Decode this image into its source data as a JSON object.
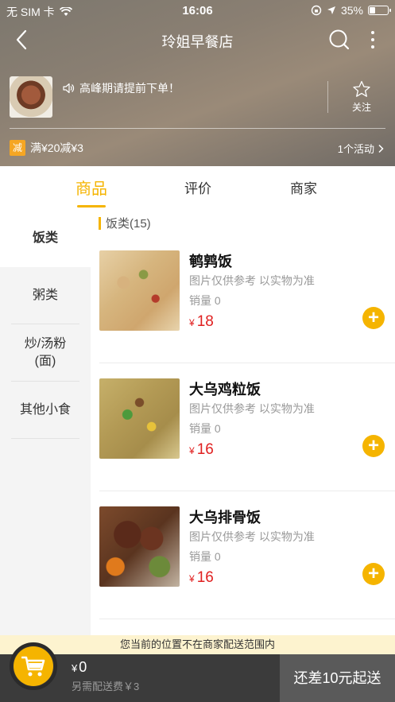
{
  "status_bar": {
    "carrier": "无 SIM 卡",
    "time": "16:06",
    "battery_percent": "35%",
    "battery_level": 0.35
  },
  "nav": {
    "title": "玲姐早餐店"
  },
  "shop": {
    "notice": "高峰期请提前下单！",
    "follow_label": "关注",
    "promo_badge": "减",
    "promo_text": "满¥20减¥3",
    "activity_label": "1个活动"
  },
  "tabs": [
    {
      "label": "商品",
      "active": true
    },
    {
      "label": "评价",
      "active": false
    },
    {
      "label": "商家",
      "active": false
    }
  ],
  "categories": [
    {
      "label": "饭类",
      "active": true
    },
    {
      "label": "粥类",
      "active": false
    },
    {
      "label": "炒/汤粉\n(面)",
      "active": false
    },
    {
      "label": "其他小食",
      "active": false
    }
  ],
  "section_title": "饭类(15)",
  "products": [
    {
      "name": "鹌鹑饭",
      "note": "图片仅供参考 以实物为准",
      "sales": "销量 0",
      "currency": "¥",
      "price": "18"
    },
    {
      "name": "大乌鸡粒饭",
      "note": "图片仅供参考 以实物为准",
      "sales": "销量 0",
      "currency": "¥",
      "price": "16"
    },
    {
      "name": "大乌排骨饭",
      "note": "图片仅供参考 以实物为准",
      "sales": "销量 0",
      "currency": "¥",
      "price": "16"
    }
  ],
  "delivery_notice": "您当前的位置不在商家配送范围内",
  "cart": {
    "currency": "¥",
    "total": "0",
    "delivery_fee": "另需配送费￥3",
    "checkout_label": "还差10元起送"
  },
  "colors": {
    "accent": "#f5b400",
    "price": "#e02020",
    "cart_bar": "#3b3b3b"
  },
  "icons": [
    "back-icon",
    "wifi-icon",
    "search-icon",
    "more-icon",
    "speaker-icon",
    "star-icon",
    "cart-icon",
    "plus-icon",
    "chevron-right-icon"
  ]
}
